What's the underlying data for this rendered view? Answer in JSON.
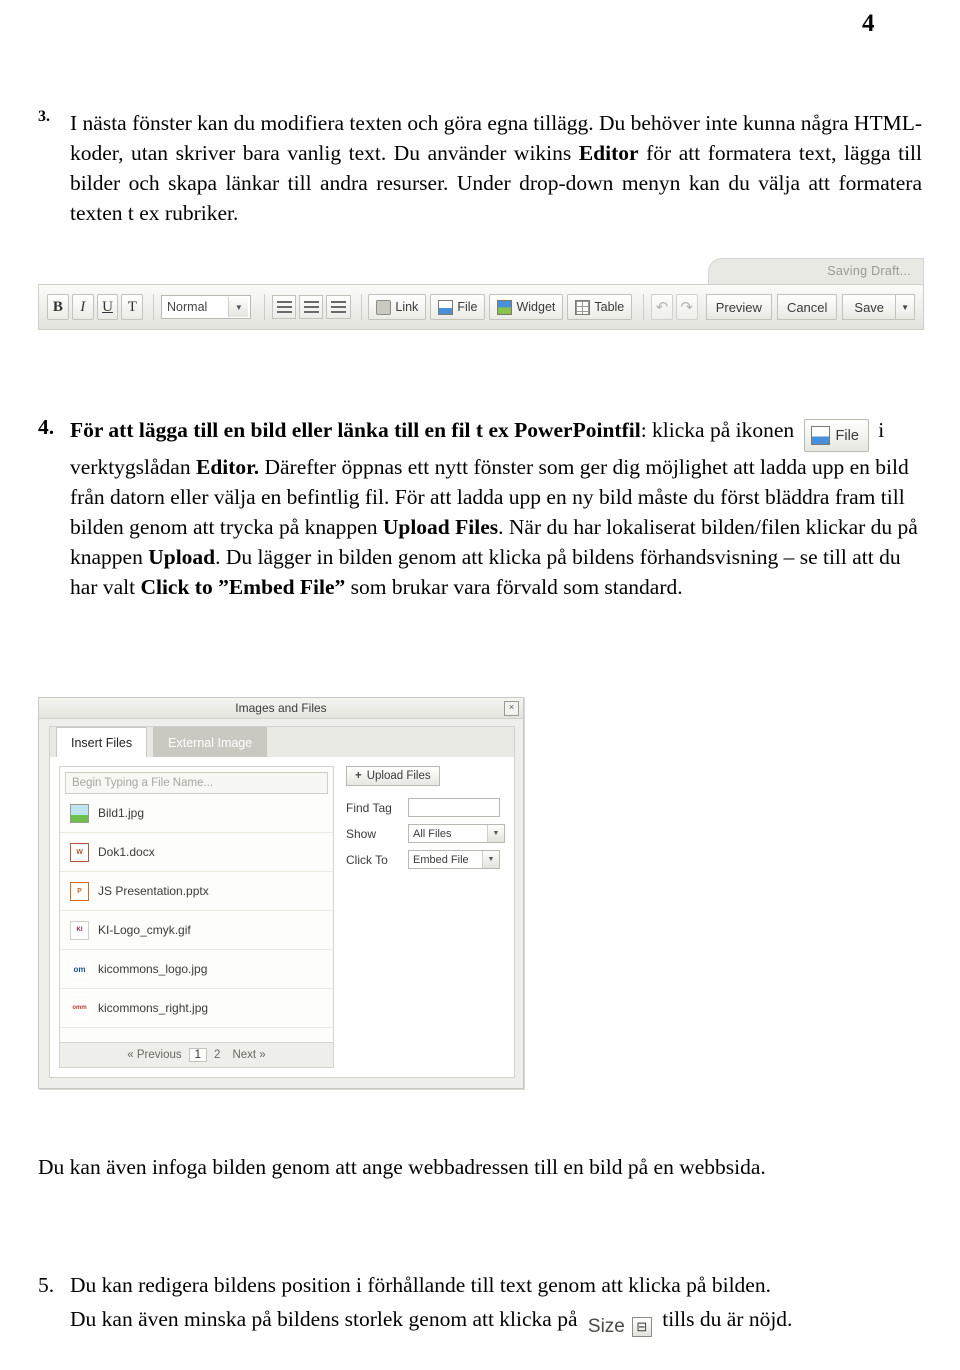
{
  "page": {
    "number": "4"
  },
  "item3": {
    "num": "3.",
    "text_line1": "I nästa fönster kan du modifiera texten och göra egna tillägg. Du behöver inte kunna några HTML-koder, utan skriver bara vanlig text. Du använder wikins ",
    "bold_editor": "Editor",
    "text_line2": " för att formatera text, lägga till bilder och skapa länkar till andra resurser. Under drop-down menyn kan du välja att formatera texten t ex rubriker."
  },
  "toolbar": {
    "saving_draft": "Saving Draft...",
    "bold": "B",
    "italic": "I",
    "underline": "U",
    "clear_format": "T",
    "style_select": "Normal",
    "list_bulleted": "bulleted-list",
    "list_numbered": "numbered-list",
    "list_indent": "indent-list",
    "link": "Link",
    "file": "File",
    "widget": "Widget",
    "table": "Table",
    "undo": "↶",
    "redo": "↷",
    "preview": "Preview",
    "cancel": "Cancel",
    "save": "Save",
    "save_arrow": "▼"
  },
  "item4": {
    "num": "4.",
    "heading_bold": "För att lägga till en bild eller länka till en fil t ex PowerPointfil",
    "after_heading": ": klicka på ikonen ",
    "file_button": "File",
    "seg1": " i verktygslådan ",
    "bold_editor": "Editor.",
    "seg2": " Därefter öppnas ett nytt fönster som ger dig möjlighet att ladda upp en bild från datorn eller välja en befintlig fil. För att ladda upp en ny bild måste du först bläddra fram till bilden genom att trycka på knappen ",
    "bold_upload_files": "Upload Files",
    "seg3": ". När du har lokaliserat bilden/filen klickar du på knappen ",
    "bold_upload": "Upload",
    "seg4": ". Du lägger in bilden genom att klicka på bildens förhandsvisning – se till att du har valt ",
    "bold_click_embed": "Click to ”Embed File”",
    "seg5": " som brukar vara förvald som standard."
  },
  "dialog": {
    "title": "Images and Files",
    "close": "×",
    "tabs": [
      {
        "label": "Insert Files",
        "state": "active"
      },
      {
        "label": "External Image",
        "state": "dark"
      }
    ],
    "search_placeholder": "Begin Typing a File Name...",
    "files": [
      {
        "name": "Bild1.jpg",
        "icon": "image-file-icon",
        "glyph": ""
      },
      {
        "name": "Dok1.docx",
        "icon": "word-file-icon",
        "glyph": "W"
      },
      {
        "name": "JS Presentation.pptx",
        "icon": "powerpoint-file-icon",
        "glyph": "P"
      },
      {
        "name": "KI-Logo_cmyk.gif",
        "icon": "ki-logo-file-icon",
        "glyph": "KI"
      },
      {
        "name": "kicommons_logo.jpg",
        "icon": "kicommons-logo-file-icon",
        "glyph": "om"
      },
      {
        "name": "kicommons_right.jpg",
        "icon": "kicommons-right-file-icon",
        "glyph": "omm"
      }
    ],
    "pager": {
      "previous": "« Previous",
      "pages": [
        "1",
        "2"
      ],
      "current": "1",
      "next": "Next »"
    },
    "upload_files_button": "Upload Files",
    "upload_plus": "+",
    "find_tag_label": "Find Tag",
    "find_tag_value": "",
    "show_label": "Show",
    "show_value": "All Files",
    "click_to_label": "Click To",
    "click_to_value": "Embed File",
    "caret": "▼"
  },
  "closing": {
    "text": "Du kan även infoga bilden genom att ange webbadressen till en bild på en webbsida."
  },
  "item5": {
    "num": "5.",
    "line1": "Du kan redigera bildens position i förhållande till text genom att klicka på bilden.",
    "line2_a": "Du kan även minska på bildens storlek genom att klicka på ",
    "size_label": "Size",
    "size_glyph": "⊟",
    "line2_b": " tills du är nöjd."
  }
}
